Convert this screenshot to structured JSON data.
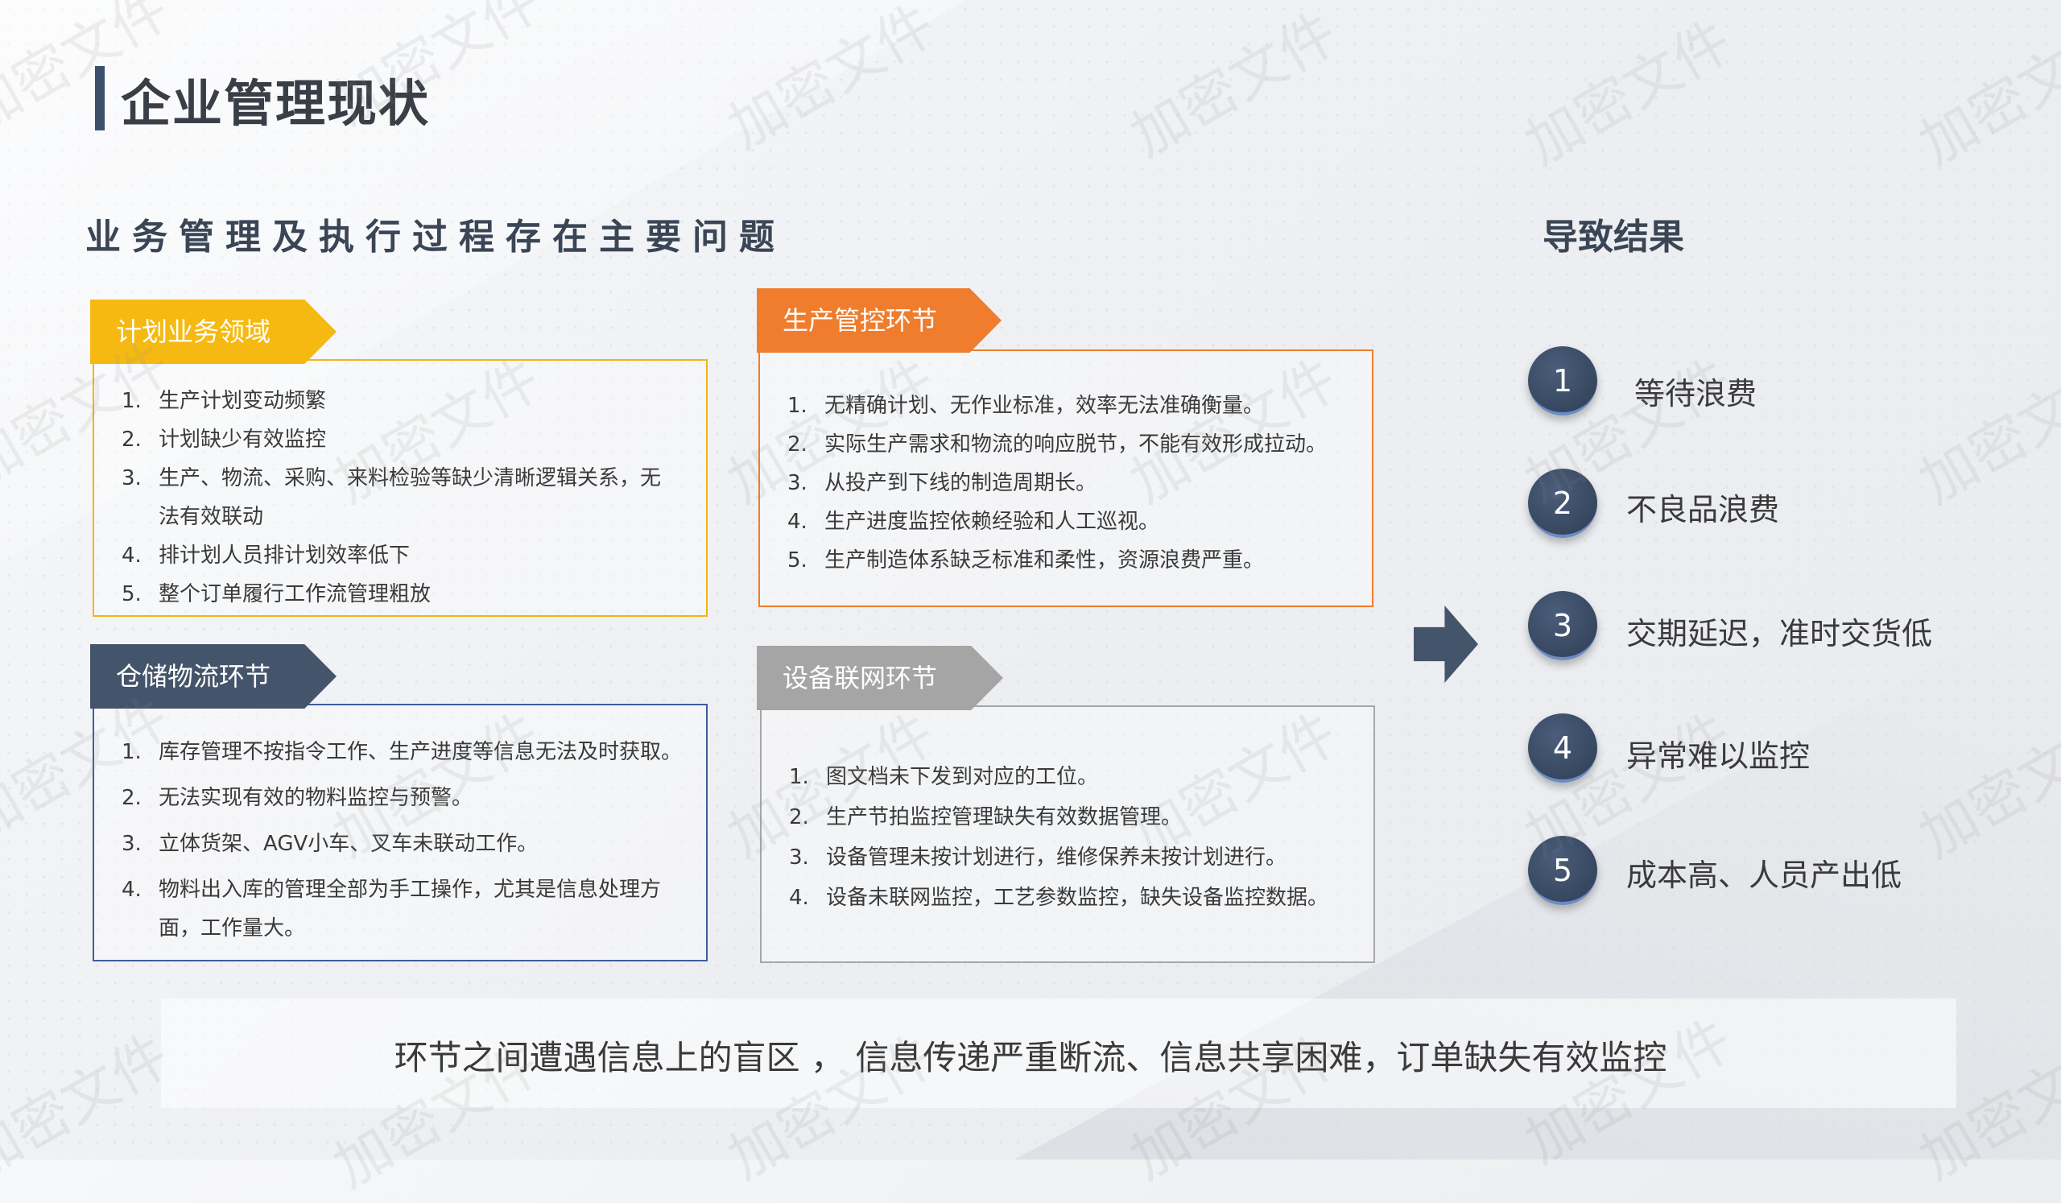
{
  "title": "企业管理现状",
  "subtitle": "业务管理及执行过程存在主要问题",
  "result_title": "导致结果",
  "watermark": "加密文件",
  "colors": {
    "plan": "#f5b912",
    "production": "#ef7d2d",
    "warehouse": "#44546a",
    "equipment": "#a5a5a5",
    "accent": "#3d4f6b"
  },
  "sections": {
    "plan": {
      "label": "计划业务领域",
      "items": [
        {
          "n": "1.",
          "t": "生产计划变动频繁"
        },
        {
          "n": "2.",
          "t": "计划缺少有效监控"
        },
        {
          "n": "3.",
          "t": "生产、物流、采购、来料检验等缺少清晰逻辑关系，无法有效联动"
        },
        {
          "n": "4.",
          "t": "排计划人员排计划效率低下"
        },
        {
          "n": "5.",
          "t": "整个订单履行工作流管理粗放"
        }
      ]
    },
    "production": {
      "label": "生产管控环节",
      "items": [
        {
          "n": "1.",
          "t": "无精确计划、无作业标准，效率无法准确衡量。"
        },
        {
          "n": "2.",
          "t": "实际生产需求和物流的响应脱节，不能有效形成拉动。"
        },
        {
          "n": "3.",
          "t": " 从投产到下线的制造周期长。"
        },
        {
          "n": "4.",
          "t": "生产进度监控依赖经验和人工巡视。"
        },
        {
          "n": "5.",
          "t": "生产制造体系缺乏标准和柔性，资源浪费严重。"
        }
      ]
    },
    "warehouse": {
      "label": "仓储物流环节",
      "items": [
        {
          "n": "1.",
          "t": "库存管理不按指令工作、生产进度等信息无法及时获取。"
        },
        {
          "n": "2.",
          "t": "无法实现有效的物料监控与预警。"
        },
        {
          "n": "3.",
          "t": "立体货架、AGV小车、叉车未联动工作。"
        },
        {
          "n": "4.",
          "t": "物料出入库的管理全部为手工操作，尤其是信息处理方面，工作量大。"
        }
      ]
    },
    "equipment": {
      "label": "设备联网环节",
      "items": [
        {
          "n": "1.",
          "t": "图文档未下发到对应的工位。"
        },
        {
          "n": "2.",
          "t": "生产节拍监控管理缺失有效数据管理。"
        },
        {
          "n": "3.",
          "t": "设备管理未按计划进行，维修保养未按计划进行。"
        },
        {
          "n": "4.",
          "t": "设备未联网监控，工艺参数监控，缺失设备监控数据。"
        }
      ]
    }
  },
  "results": [
    {
      "n": "1",
      "t": "等待浪费"
    },
    {
      "n": "2",
      "t": "不良品浪费"
    },
    {
      "n": "3",
      "t": "交期延迟，准时交货低"
    },
    {
      "n": "4",
      "t": "异常难以监控"
    },
    {
      "n": "5",
      "t": "成本高、人员产出低"
    }
  ],
  "conclusion": "环节之间遭遇信息上的盲区 ， 信息传递严重断流、信息共享困难，订单缺失有效监控"
}
